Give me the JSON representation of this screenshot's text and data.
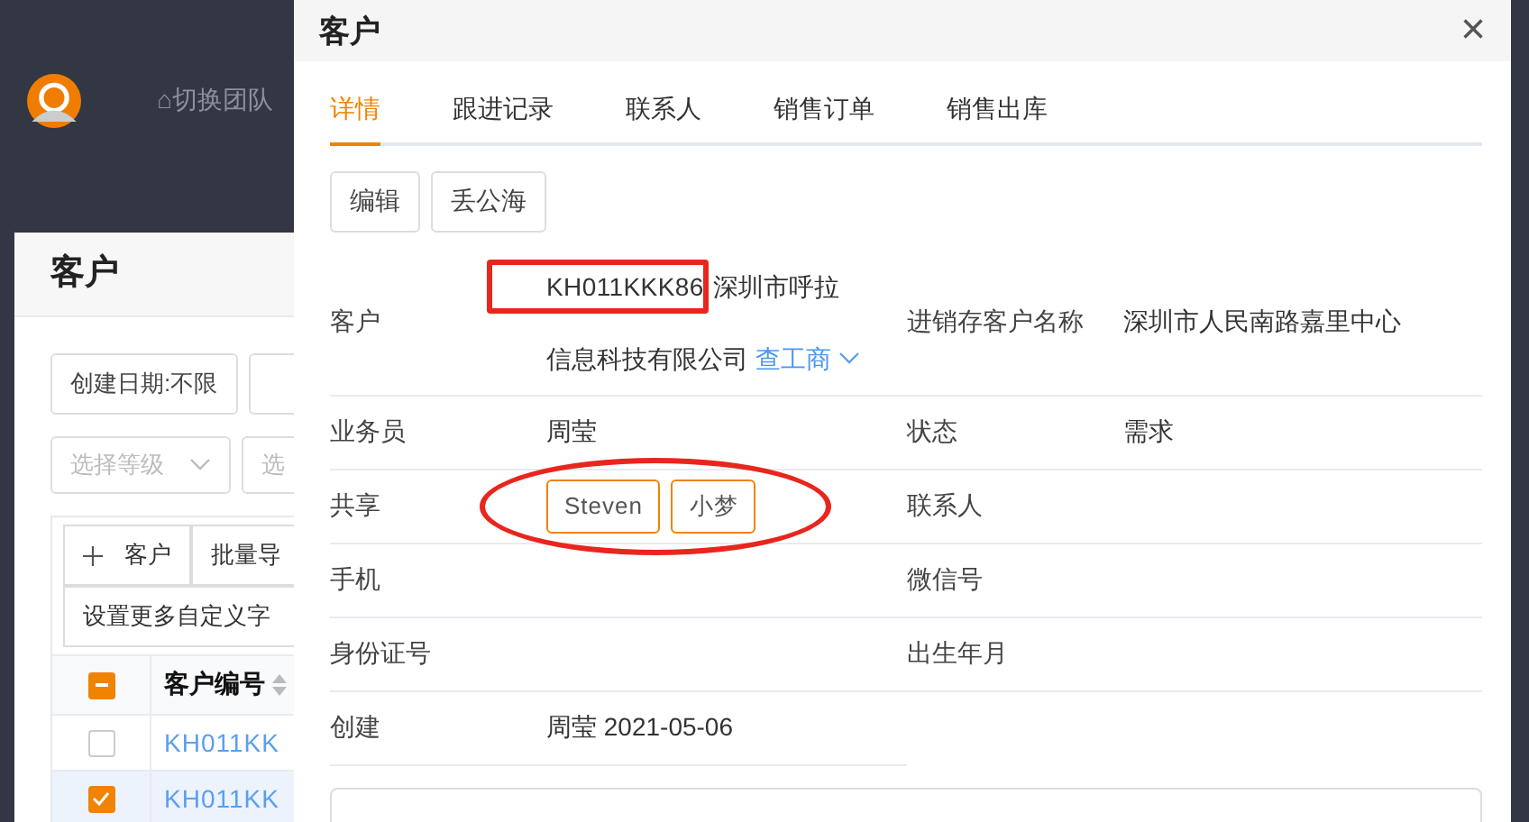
{
  "topbar": {
    "team_switch": "⌂切换团队"
  },
  "list_page": {
    "title": "客户",
    "filters": [
      {
        "kind": "button",
        "label": "创建日期:不限"
      },
      {
        "kind": "button"
      }
    ],
    "selects": [
      {
        "placeholder": "选择等级",
        "chevron": true
      },
      {
        "placeholder": "选"
      }
    ],
    "toolbar": [
      {
        "kind": "add",
        "label": "客户"
      },
      {
        "kind": "plain",
        "label": "批量导"
      }
    ],
    "custom_fields_button": "设置更多自定义字",
    "table": {
      "select_all_indeterminate": true,
      "columns": [
        "客户编号"
      ],
      "rows": [
        {
          "cells": [
            "KH011KK"
          ],
          "selected": false
        },
        {
          "cells": [
            "KH011KK"
          ],
          "selected": true
        }
      ]
    }
  },
  "drawer": {
    "title": "客户",
    "close": "×",
    "tabs": [
      {
        "label": "详情",
        "selected": true
      },
      {
        "label": "跟进记录",
        "selected": false
      },
      {
        "label": "联系人",
        "selected": false
      },
      {
        "label": "销售订单",
        "selected": false
      },
      {
        "label": "销售出库",
        "selected": false
      }
    ],
    "actions": [
      "编辑",
      "丢公海"
    ],
    "rows": [
      {
        "fields": [
          {
            "label": "客户",
            "kind": "customer",
            "code": "KH011KKK86",
            "value_lines": [
              "深圳市呼拉",
              "信息科技有限公司"
            ],
            "link": "查工商",
            "annotation": {
              "kind": "box"
            }
          },
          {
            "label": "进销存客户名称",
            "kind": "text",
            "value": "深圳市人民南路嘉里中心"
          }
        ]
      },
      {
        "fields": [
          {
            "label": "业务员",
            "kind": "text",
            "value": "周莹"
          },
          {
            "label": "状态",
            "kind": "text",
            "value": "需求"
          }
        ]
      },
      {
        "fields": [
          {
            "label": "共享",
            "kind": "tags",
            "tags": [
              "Steven",
              "小梦"
            ],
            "annotation": {
              "kind": "ellipse"
            }
          },
          {
            "label": "联系人",
            "kind": "text"
          }
        ]
      },
      {
        "fields": [
          {
            "label": "手机",
            "kind": "text"
          },
          {
            "label": "微信号",
            "kind": "text"
          }
        ]
      },
      {
        "fields": [
          {
            "label": "身份证号",
            "kind": "text"
          },
          {
            "label": "出生年月",
            "kind": "text"
          }
        ]
      },
      {
        "fields": [
          {
            "label": "创建",
            "kind": "text",
            "value": "周莹 2021-05-06"
          }
        ]
      }
    ]
  }
}
